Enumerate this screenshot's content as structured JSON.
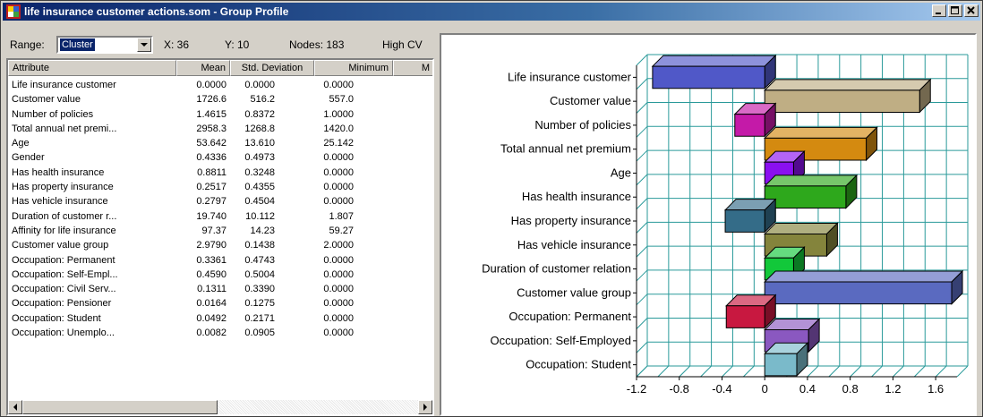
{
  "window": {
    "title": "life insurance customer actions.som - Group Profile"
  },
  "toolbar": {
    "range_label": "Range:",
    "range_value": "Cluster",
    "x_text": "X: 36",
    "y_text": "Y: 10",
    "nodes_text": "Nodes: 183",
    "view_text": "High CV"
  },
  "table": {
    "headers": [
      "Attribute",
      "Mean",
      "Std. Deviation",
      "Minimum",
      "M"
    ],
    "rows": [
      [
        "Life insurance customer",
        "0.0000",
        "0.0000",
        "0.0000"
      ],
      [
        "Customer value",
        "1726.6",
        "516.2",
        "557.0"
      ],
      [
        "Number of policies",
        "1.4615",
        "0.8372",
        "1.0000"
      ],
      [
        "Total annual net premi...",
        "2958.3",
        "1268.8",
        "1420.0"
      ],
      [
        "Age",
        "53.642",
        "13.610",
        "25.142"
      ],
      [
        "Gender",
        "0.4336",
        "0.4973",
        "0.0000"
      ],
      [
        "Has health insurance",
        "0.8811",
        "0.3248",
        "0.0000"
      ],
      [
        "Has property insurance",
        "0.2517",
        "0.4355",
        "0.0000"
      ],
      [
        "Has vehicle insurance",
        "0.2797",
        "0.4504",
        "0.0000"
      ],
      [
        "Duration of customer r...",
        "19.740",
        "10.112",
        "1.807"
      ],
      [
        "Affinity for life insurance",
        "97.37",
        "14.23",
        "59.27"
      ],
      [
        "Customer value group",
        "2.9790",
        "0.1438",
        "2.0000"
      ],
      [
        "Occupation: Permanent",
        "0.3361",
        "0.4743",
        "0.0000"
      ],
      [
        "Occupation: Self-Empl...",
        "0.4590",
        "0.5004",
        "0.0000"
      ],
      [
        "Occupation: Civil Serv...",
        "0.1311",
        "0.3390",
        "0.0000"
      ],
      [
        "Occupation: Pensioner",
        "0.0164",
        "0.1275",
        "0.0000"
      ],
      [
        "Occupation: Student",
        "0.0492",
        "0.2171",
        "0.0000"
      ],
      [
        "Occupation: Unemplo...",
        "0.0082",
        "0.0905",
        "0.0000"
      ]
    ]
  },
  "chart_data": {
    "type": "bar",
    "orientation": "horizontal",
    "style": "3d",
    "categories": [
      "Life insurance customer",
      "Customer value",
      "Number of policies",
      "Total annual net premium",
      "Age",
      "Has health insurance",
      "Has property insurance",
      "Has vehicle insurance",
      "Duration of customer relation",
      "Customer value group",
      "Occupation: Permanent",
      "Occupation: Self-Employed",
      "Occupation: Student"
    ],
    "values": [
      -1.05,
      1.45,
      -0.28,
      0.95,
      0.27,
      0.76,
      -0.37,
      0.58,
      0.27,
      1.75,
      -0.36,
      0.41,
      0.3
    ],
    "colors": [
      "#5058c8",
      "#bfae84",
      "#c41aa8",
      "#d48a10",
      "#8a10f0",
      "#2ea81c",
      "#346c88",
      "#84843c",
      "#12c83a",
      "#5a6ac0",
      "#c81840",
      "#8a58c0",
      "#7abaca"
    ],
    "xlim": [
      -1.2,
      1.8
    ],
    "xticks": [
      "-1.2",
      "-0.8",
      "-0.4",
      "0",
      "0.4",
      "0.8",
      "1.2",
      "1.6"
    ],
    "grid": true,
    "grid_color": "#2a9a9a"
  }
}
